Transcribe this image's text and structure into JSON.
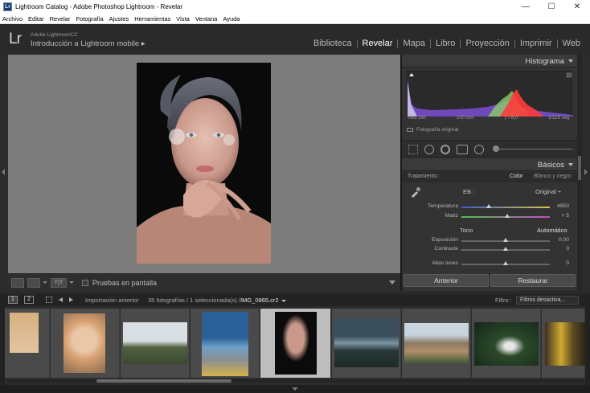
{
  "window": {
    "title": "Lightroom Catalog - Adobe Photoshop Lightroom - Revelar",
    "icon_label": "Lr",
    "minimize": "—",
    "maximize": "☐",
    "close": "✕"
  },
  "menu": [
    "Archivo",
    "Editar",
    "Revelar",
    "Fotografía",
    "Ajustes",
    "Herramientas",
    "Vista",
    "Ventana",
    "Ayuda"
  ],
  "identity": {
    "logo": "Lr",
    "subtitle": "Adobe LightroomCC",
    "task": "Introducción a Lightroom mobile ▸"
  },
  "modules": [
    "Biblioteca",
    "Revelar",
    "Mapa",
    "Libro",
    "Proyección",
    "Imprimir",
    "Web"
  ],
  "active_module": "Revelar",
  "toolbar": {
    "view_mode_icons": [
      "loupe-view-icon",
      "before-after-icon",
      "before-after-split-icon"
    ],
    "view_yy": "Y|Y",
    "soft_proof_label": "Pruebas en pantalla"
  },
  "histogram": {
    "title": "Histograma",
    "iso": "ISO 160",
    "focal": "100 mm",
    "aperture": "ƒ / 8,0",
    "shutter": "1/125 seg.",
    "original_photo": "Fotografía original"
  },
  "basics": {
    "title": "Básicos",
    "treatment_label": "Tratamiento :",
    "treatment_color": "Color",
    "treatment_bw": "Blanco y negro",
    "wb_label": "EB :",
    "wb_value": "Original ÷",
    "tone_label": "Tono",
    "tone_auto": "Automático",
    "sliders": [
      {
        "label": "Temperatura",
        "value": "4950",
        "pos": 0.48
      },
      {
        "label": "Matiz",
        "value": "+ 5",
        "pos": 0.52
      },
      {
        "label": "Exposición",
        "value": "0,00",
        "pos": 0.5
      },
      {
        "label": "Contraste",
        "value": "0",
        "pos": 0.5
      },
      {
        "label": "Altas luces",
        "value": "0",
        "pos": 0.5
      }
    ]
  },
  "buttons": {
    "previous": "Anterior",
    "reset": "Restaurar"
  },
  "filmstrip": {
    "page1": "1",
    "page2": "2",
    "previous_import": "Importación anterior",
    "count": "35 fotografías / 1 seleccionada(s) /",
    "filename": "IMG_0865.cr2",
    "filter_label": "Filtro :",
    "filter_value": "Filtros desactiva...",
    "selected_index": 4
  },
  "colors": {
    "accent_histogram_red": "#ff3b3b",
    "accent_histogram_purple": "#7b4fd6",
    "panel_bg": "#333333",
    "selected_cell": "#bdbdbd"
  }
}
